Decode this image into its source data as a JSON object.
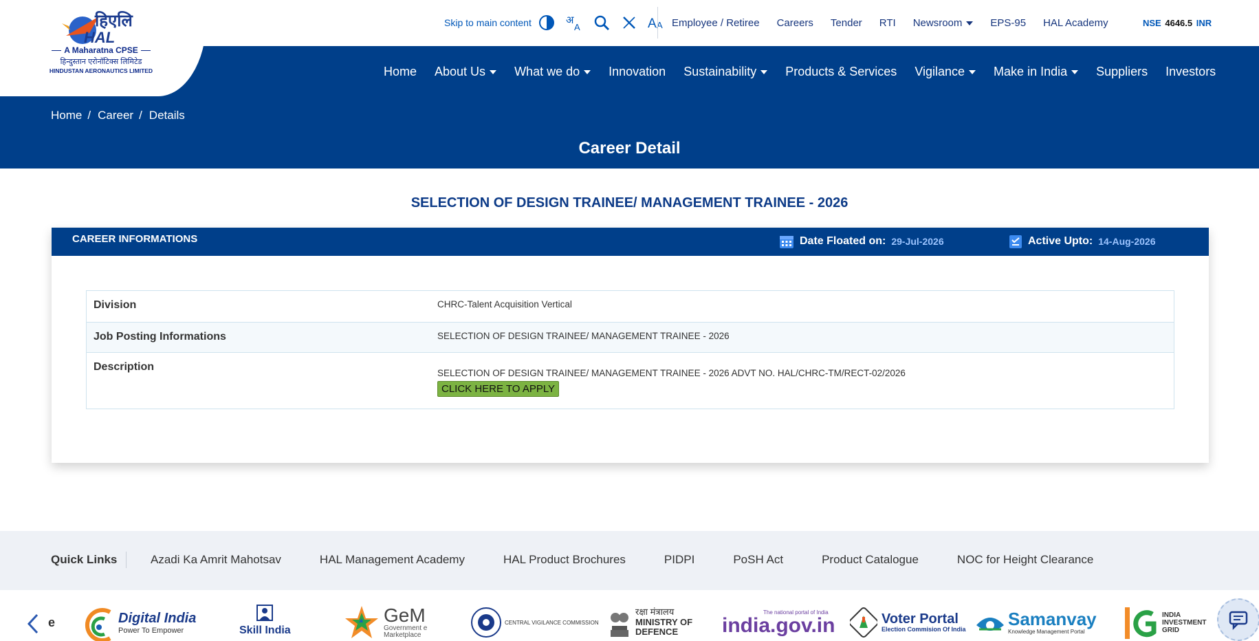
{
  "header": {
    "logo": {
      "hindi_mark": "हिएलि",
      "english_mark": "HAL",
      "tagline": "A Maharatna CPSE",
      "hindi_name": "हिन्दुस्तान एरोनॉटिक्स लिमिटेड",
      "english_name": "HINDUSTAN AERONAUTICS LIMITED"
    },
    "skip_link": "Skip to main content",
    "utility_icons": [
      "contrast-icon",
      "language-icon",
      "search-icon",
      "x-twitter-icon",
      "font-size-icon"
    ],
    "top_links": [
      {
        "label": "Employee / Retiree",
        "dropdown": false
      },
      {
        "label": "Careers",
        "dropdown": false
      },
      {
        "label": "Tender",
        "dropdown": false
      },
      {
        "label": "RTI",
        "dropdown": false
      },
      {
        "label": "Newsroom",
        "dropdown": true
      },
      {
        "label": "EPS-95",
        "dropdown": false
      },
      {
        "label": "HAL Academy",
        "dropdown": false
      }
    ],
    "stock": {
      "exchange": "NSE",
      "price": "4646.5",
      "currency": "INR"
    },
    "main_nav": [
      {
        "label": "Home",
        "dropdown": false
      },
      {
        "label": "About Us",
        "dropdown": true
      },
      {
        "label": "What we do",
        "dropdown": true
      },
      {
        "label": "Innovation",
        "dropdown": false
      },
      {
        "label": "Sustainability",
        "dropdown": true
      },
      {
        "label": "Products & Services",
        "dropdown": false
      },
      {
        "label": "Vigilance",
        "dropdown": true
      },
      {
        "label": "Make in India",
        "dropdown": true
      },
      {
        "label": "Suppliers",
        "dropdown": false
      },
      {
        "label": "Investors",
        "dropdown": false
      }
    ]
  },
  "banner": {
    "breadcrumb": [
      "Home",
      "Career",
      "Details"
    ],
    "title": "Career Detail"
  },
  "content": {
    "heading": "SELECTION OF DESIGN TRAINEE/ MANAGEMENT TRAINEE - 2026",
    "card": {
      "title": "CAREER INFORMATIONS",
      "date_floated_label": "Date Floated on:",
      "date_floated_value": "29-Jul-2026",
      "active_upto_label": "Active Upto:",
      "active_upto_value": "14-Aug-2026",
      "rows": [
        {
          "label": "Division",
          "value": "CHRC-Talent Acquisition Vertical"
        },
        {
          "label": "Job Posting Informations",
          "value": "SELECTION OF DESIGN TRAINEE/ MANAGEMENT TRAINEE - 2026"
        },
        {
          "label": "Description",
          "value": "SELECTION OF DESIGN TRAINEE/ MANAGEMENT TRAINEE - 2026 ADVT NO. HAL/CHRC-TM/RECT-02/2026"
        }
      ],
      "apply_button": "CLICK HERE TO APPLY"
    }
  },
  "footer": {
    "quick_links_label": "Quick Links",
    "quick_links": [
      "Azadi Ka Amrit Mahotsav",
      "HAL Management Academy",
      "HAL Product Brochures",
      "PIDPI",
      "PoSH Act",
      "Product Catalogue",
      "NOC for Height Clearance"
    ],
    "partner_logos": [
      {
        "name": "Digital India",
        "sub": "Power To Empower"
      },
      {
        "name": "Skill India",
        "sub": ""
      },
      {
        "name": "GeM",
        "sub": "Government e Marketplace"
      },
      {
        "name": "CENTRAL VIGILANCE COMMISSION",
        "sub": ""
      },
      {
        "name": "MINISTRY OF DEFENCE",
        "sub": "रक्षा मंत्रालय"
      },
      {
        "name": "india.gov.in",
        "sub": "The national portal of India"
      },
      {
        "name": "Voter Portal",
        "sub": "Election Commision Of India"
      },
      {
        "name": "Samanvay",
        "sub": "Knowledge Management Portal"
      },
      {
        "name": "INDIA INVESTMENT GRID",
        "sub": ""
      }
    ],
    "partial_logo_text": "e"
  },
  "colors": {
    "navy": "#003f8a",
    "link_blue": "#0057b8",
    "heading_blue": "#0c3a87",
    "apply_green": "#7cb342"
  }
}
